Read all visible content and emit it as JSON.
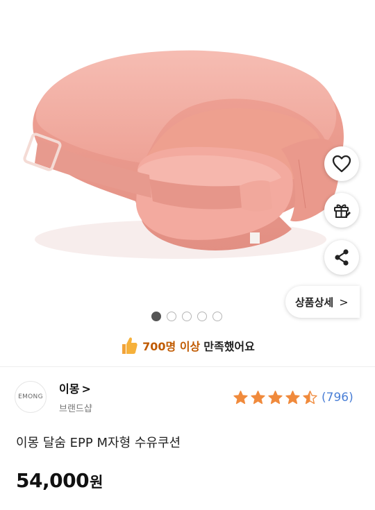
{
  "product_image": {
    "alt": "이몽 달숨 EPP M자형 수유쿠션",
    "color": "#f0a79e"
  },
  "actions": {
    "like_icon": "heart-icon",
    "gift_icon": "gift-icon",
    "share_icon": "share-icon",
    "detail_label": "상품상세",
    "detail_chevron": ">"
  },
  "carousel": {
    "total": 5,
    "active_index": 0
  },
  "satisfaction": {
    "icon": "thumbs-up-icon",
    "highlight": "700명 이상",
    "text": "만족했어요"
  },
  "brand": {
    "logo_text": "EMONG",
    "name": "이몽",
    "chevron": ">",
    "subtitle": "브랜드샵"
  },
  "rating": {
    "stars": 4.5,
    "max": 5,
    "review_count": "(796)",
    "star_color": "#f08a3c"
  },
  "product": {
    "name": "이몽 달숨 EPP M자형 수유쿠션",
    "price": "54,000",
    "currency": "원"
  }
}
